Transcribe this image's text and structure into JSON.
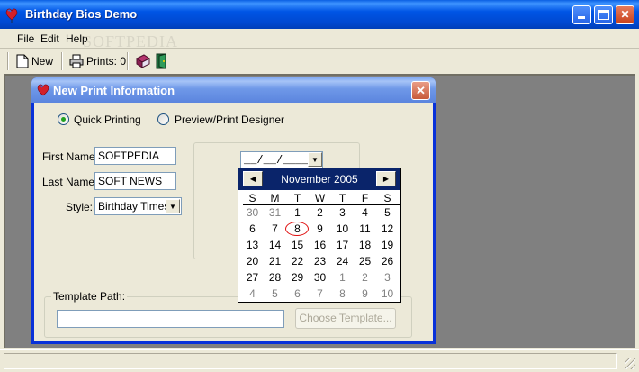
{
  "window": {
    "title": "Birthday Bios Demo",
    "menu": [
      {
        "label": "File",
        "accel": "F"
      },
      {
        "label": "Edit",
        "accel": "E"
      },
      {
        "label": "Help",
        "accel": "H"
      }
    ],
    "watermark": "SOFTPEDIA",
    "toolbar": {
      "new_label": "New",
      "prints_label": "Prints: 0"
    }
  },
  "dialog": {
    "title": "New Print Information",
    "radio_quick": "Quick Printing",
    "radio_preview": "Preview/Print Designer",
    "selected_mode": "Quick Printing",
    "first_name_label": "First Name:",
    "first_name_value": "SOFTPEDIA",
    "last_name_label": "Last Name:",
    "last_name_value": "SOFT NEWS",
    "style_label": "Style:",
    "style_value": "Birthday Times",
    "date_value": "__/__/____",
    "template_label": "Template Path:",
    "template_value": "",
    "choose_template_label": "Choose Template...",
    "choose_template_enabled": false
  },
  "calendar": {
    "month_label": "November 2005",
    "days_of_week": [
      "S",
      "M",
      "T",
      "W",
      "T",
      "F",
      "S"
    ],
    "today": "8",
    "weeks": [
      [
        {
          "d": "30",
          "o": true
        },
        {
          "d": "31",
          "o": true
        },
        {
          "d": "1"
        },
        {
          "d": "2"
        },
        {
          "d": "3"
        },
        {
          "d": "4"
        },
        {
          "d": "5"
        }
      ],
      [
        {
          "d": "6"
        },
        {
          "d": "7"
        },
        {
          "d": "8"
        },
        {
          "d": "9"
        },
        {
          "d": "10"
        },
        {
          "d": "11"
        },
        {
          "d": "12"
        }
      ],
      [
        {
          "d": "13"
        },
        {
          "d": "14"
        },
        {
          "d": "15"
        },
        {
          "d": "16"
        },
        {
          "d": "17"
        },
        {
          "d": "18"
        },
        {
          "d": "19"
        }
      ],
      [
        {
          "d": "20"
        },
        {
          "d": "21"
        },
        {
          "d": "22"
        },
        {
          "d": "23"
        },
        {
          "d": "24"
        },
        {
          "d": "25"
        },
        {
          "d": "26"
        }
      ],
      [
        {
          "d": "27"
        },
        {
          "d": "28"
        },
        {
          "d": "29"
        },
        {
          "d": "30"
        },
        {
          "d": "1",
          "o": true
        },
        {
          "d": "2",
          "o": true
        },
        {
          "d": "3",
          "o": true
        }
      ],
      [
        {
          "d": "4",
          "o": true
        },
        {
          "d": "5",
          "o": true
        },
        {
          "d": "6",
          "o": true
        },
        {
          "d": "7",
          "o": true
        },
        {
          "d": "8",
          "o": true
        },
        {
          "d": "9",
          "o": true
        },
        {
          "d": "10",
          "o": true
        }
      ]
    ]
  },
  "colors": {
    "titlebar_blue": "#0055e5",
    "dialog_title_blue": "#6f98e8",
    "calendar_header": "#0a246a",
    "workspace_gray": "#808080",
    "today_circle": "#e01010"
  }
}
